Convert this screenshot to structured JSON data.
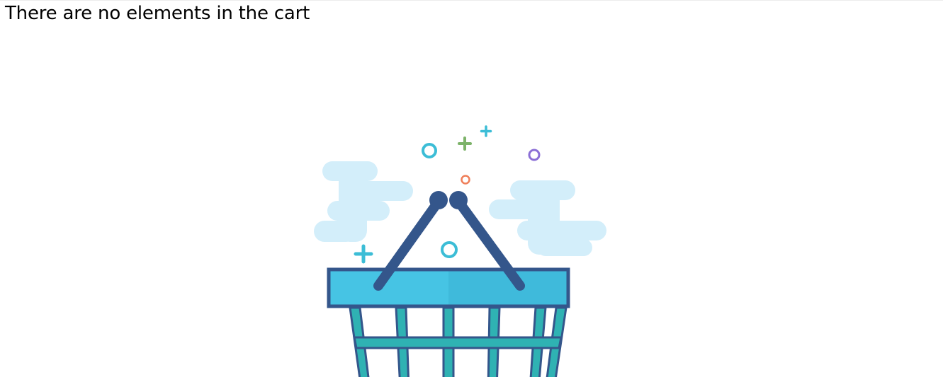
{
  "page": {
    "empty_cart_message": "There are no elements in the cart"
  },
  "illustration": {
    "icon": "empty-shopping-basket",
    "colors": {
      "cloud": "#d3eefa",
      "basket_outline": "#34568b",
      "basket_rim": "#46c4e4",
      "basket_mesh": "#2fb2b3",
      "sparkle_cyan": "#3cbdd6",
      "sparkle_green": "#7db36a",
      "sparkle_purple": "#8b6fd6",
      "sparkle_orange": "#ef7f5a"
    }
  }
}
